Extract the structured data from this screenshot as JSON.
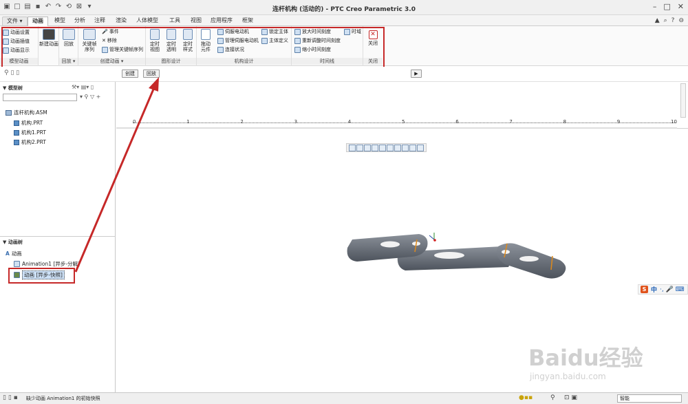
{
  "window": {
    "title": "连杆机构 (活动的) - PTC Creo Parametric 3.0"
  },
  "tabs": [
    "文件 ▾",
    "动画",
    "模型",
    "分析",
    "注释",
    "渲染",
    "人体模型",
    "工具",
    "视图",
    "应用程序",
    "框架"
  ],
  "active_tab": "动画",
  "ribbon": {
    "groups": [
      {
        "label": "模型动画"
      },
      {
        "label": "回放 ▾"
      },
      {
        "label": "创建动画 ▾"
      },
      {
        "label": "图形设计"
      },
      {
        "label": "机构设计"
      },
      {
        "label": "时间线"
      },
      {
        "label": "关闭"
      }
    ],
    "model_anim": [
      "动画设置",
      "动画插值",
      "动画显示"
    ],
    "new_anim": "新建动画",
    "playback": "回放",
    "keyframe": "关键帧\n序列",
    "events": [
      "事件",
      "移除",
      "管理关键帧序列"
    ],
    "graphics": [
      "定时\n视图",
      "定时\n透明",
      "定时\n样式"
    ],
    "drag": "拖动\n元件",
    "mech": [
      "伺服电动机",
      "管理伺服电动机",
      "连接状况"
    ],
    "mech2": [
      "锁定主体",
      "主体定义"
    ],
    "timeline": [
      "放大时间刻度",
      "重新调整时间刻度",
      "缩小时间刻度"
    ],
    "timeline_btn": "时域",
    "close": "关闭"
  },
  "subbar": {
    "create": "创建",
    "playback": "回放"
  },
  "model_tree": {
    "header": "模型树",
    "items": [
      "连杆机构.ASM",
      "机构.PRT",
      "机构1.PRT",
      "机构2.PRT"
    ]
  },
  "anim_tree": {
    "header": "动画树",
    "root": "动画",
    "items": [
      "Animation1 [异步-分解]",
      "动画 [异步-快照]"
    ]
  },
  "timeline": {
    "ticks": [
      "0",
      "1",
      "2",
      "3",
      "4",
      "5",
      "6",
      "7",
      "8",
      "9",
      "10"
    ]
  },
  "status": {
    "message": "缺少动画 Animation1 的初始快照",
    "filter": "智能"
  },
  "ime": {
    "label": "中"
  },
  "watermark": {
    "brand": "Baidu经验",
    "url": "jingyan.baidu.com"
  }
}
